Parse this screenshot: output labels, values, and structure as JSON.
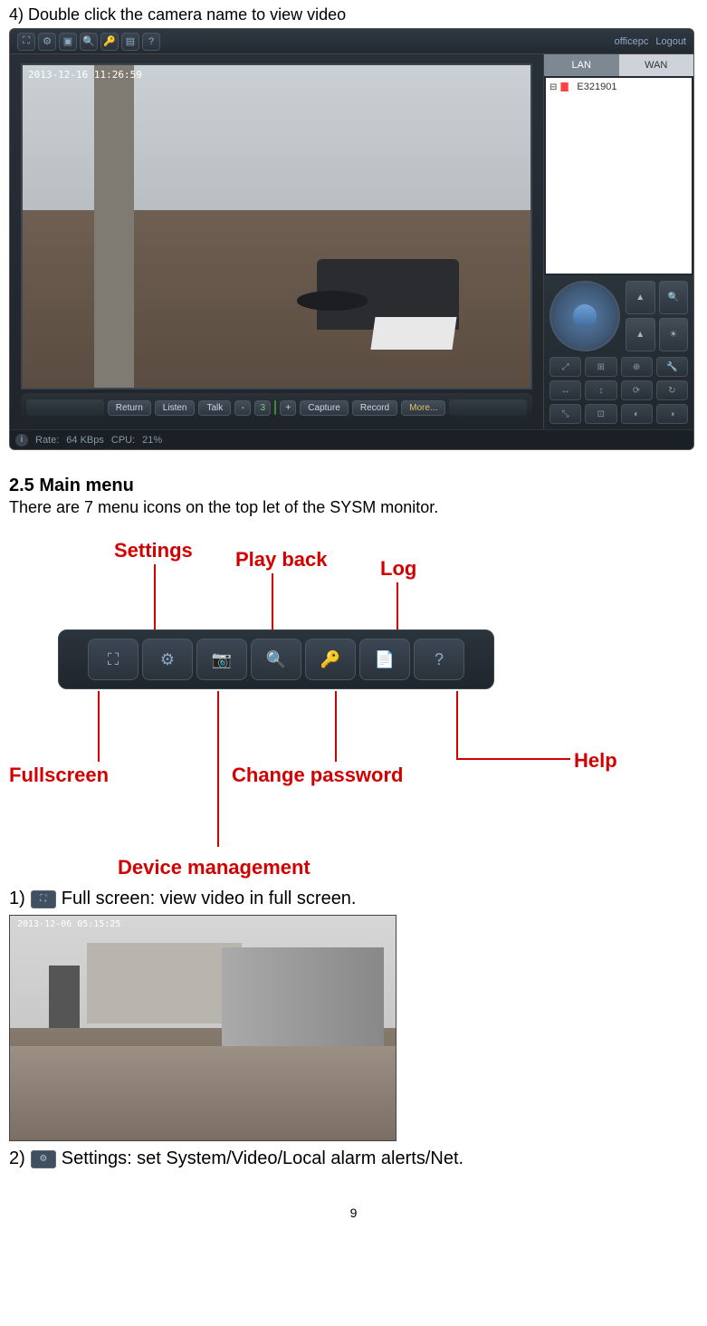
{
  "step4_text": "4) Double click the camera name to view video",
  "monitor": {
    "user": "officepc",
    "logout": "Logout",
    "tabs": {
      "lan": "LAN",
      "wan": "WAN"
    },
    "device": "E321901",
    "timestamp": "2013-12-16 11:26:59",
    "controls": {
      "return": "Return",
      "listen": "Listen",
      "talk": "Talk",
      "minus": "-",
      "num": "3",
      "plus": "+",
      "capture": "Capture",
      "record": "Record",
      "more": "More..."
    },
    "ptz_side": [
      "▲",
      "🔍",
      "▲",
      "☀"
    ],
    "ptz_grid": [
      "⤢",
      "⊞",
      "⊕",
      "🔧",
      "↔",
      "↕",
      "⟳",
      "↻",
      "⤡",
      "⊡",
      "◐",
      "◑"
    ],
    "status": {
      "rate_label": "Rate:",
      "rate_val": "64 KBps",
      "cpu_label": "CPU:",
      "cpu_val": "21%"
    }
  },
  "section": {
    "num_title": "2.5 Main menu",
    "desc": "There are 7 menu icons on the top let of the SYSM monitor."
  },
  "diagram": {
    "labels": {
      "settings": "Settings",
      "playback": "Play back",
      "log": "Log",
      "fullscreen": "Fullscreen",
      "changepwd": "Change password",
      "help": "Help",
      "devmgmt": "Device management"
    },
    "icons": [
      "⛶",
      "⚙",
      "📷",
      "🔍",
      "🔑",
      "📄",
      "?"
    ]
  },
  "item1": {
    "num": "1)",
    "text": "Full screen: view video in full screen."
  },
  "fullscreen": {
    "timestamp": "2013-12-06 05:15:25",
    "badge": ""
  },
  "item2": {
    "num": "2)",
    "text": "Settings: set System/Video/Local alarm alerts/Net."
  },
  "page_number": "9"
}
